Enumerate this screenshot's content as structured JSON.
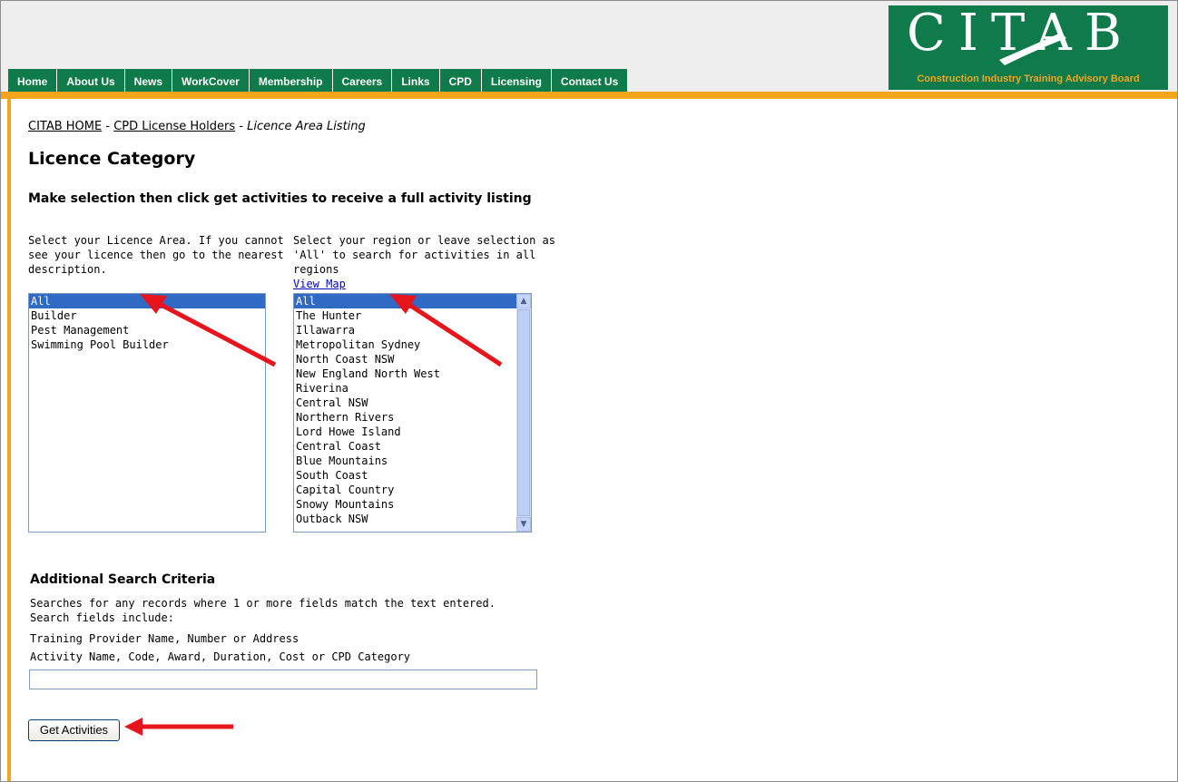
{
  "nav": [
    "Home",
    "About Us",
    "News",
    "WorkCover",
    "Membership",
    "Careers",
    "Links",
    "CPD",
    "Licensing",
    "Contact Us"
  ],
  "logo": {
    "text": "CITAB",
    "subtitle": "Construction Industry Training Advisory Board"
  },
  "breadcrumb": {
    "home": "CITAB HOME",
    "sep": " - ",
    "parent": "CPD License Holders",
    "current": "Licence Area Listing"
  },
  "title": "Licence Category",
  "instruction": "Make selection then click get activities to receive a full activity listing",
  "licence": {
    "description": "Select your Licence Area. If you cannot see your licence then go to the nearest description.",
    "options": [
      "All",
      "Builder",
      "Pest Management",
      "Swimming Pool Builder"
    ],
    "selected": "All"
  },
  "region": {
    "description": "Select your region or leave selection as 'All' to search for activities in all regions",
    "map_link": "View Map",
    "options": [
      "All",
      "The Hunter",
      "Illawarra",
      "Metropolitan Sydney",
      "North Coast NSW",
      "New England North West",
      "Riverina",
      "Central NSW",
      "Northern Rivers",
      "Lord Howe Island",
      "Central Coast",
      "Blue Mountains",
      "South Coast",
      "Capital Country",
      "Snowy Mountains",
      "Outback NSW"
    ],
    "selected": "All"
  },
  "additional": {
    "heading": "Additional Search Criteria",
    "desc": "Searches for any records where 1 or more fields match the text entered. Search fields include:",
    "line1": "Training Provider Name, Number or Address",
    "line2": "Activity Name, Code, Award, Duration, Cost or CPD Category",
    "value": ""
  },
  "button": "Get Activities",
  "colors": {
    "brand_green": "#0f7a4a",
    "accent_orange": "#f3a51d",
    "annotation_arrow": "#e8141b",
    "selection": "#316ac5"
  }
}
